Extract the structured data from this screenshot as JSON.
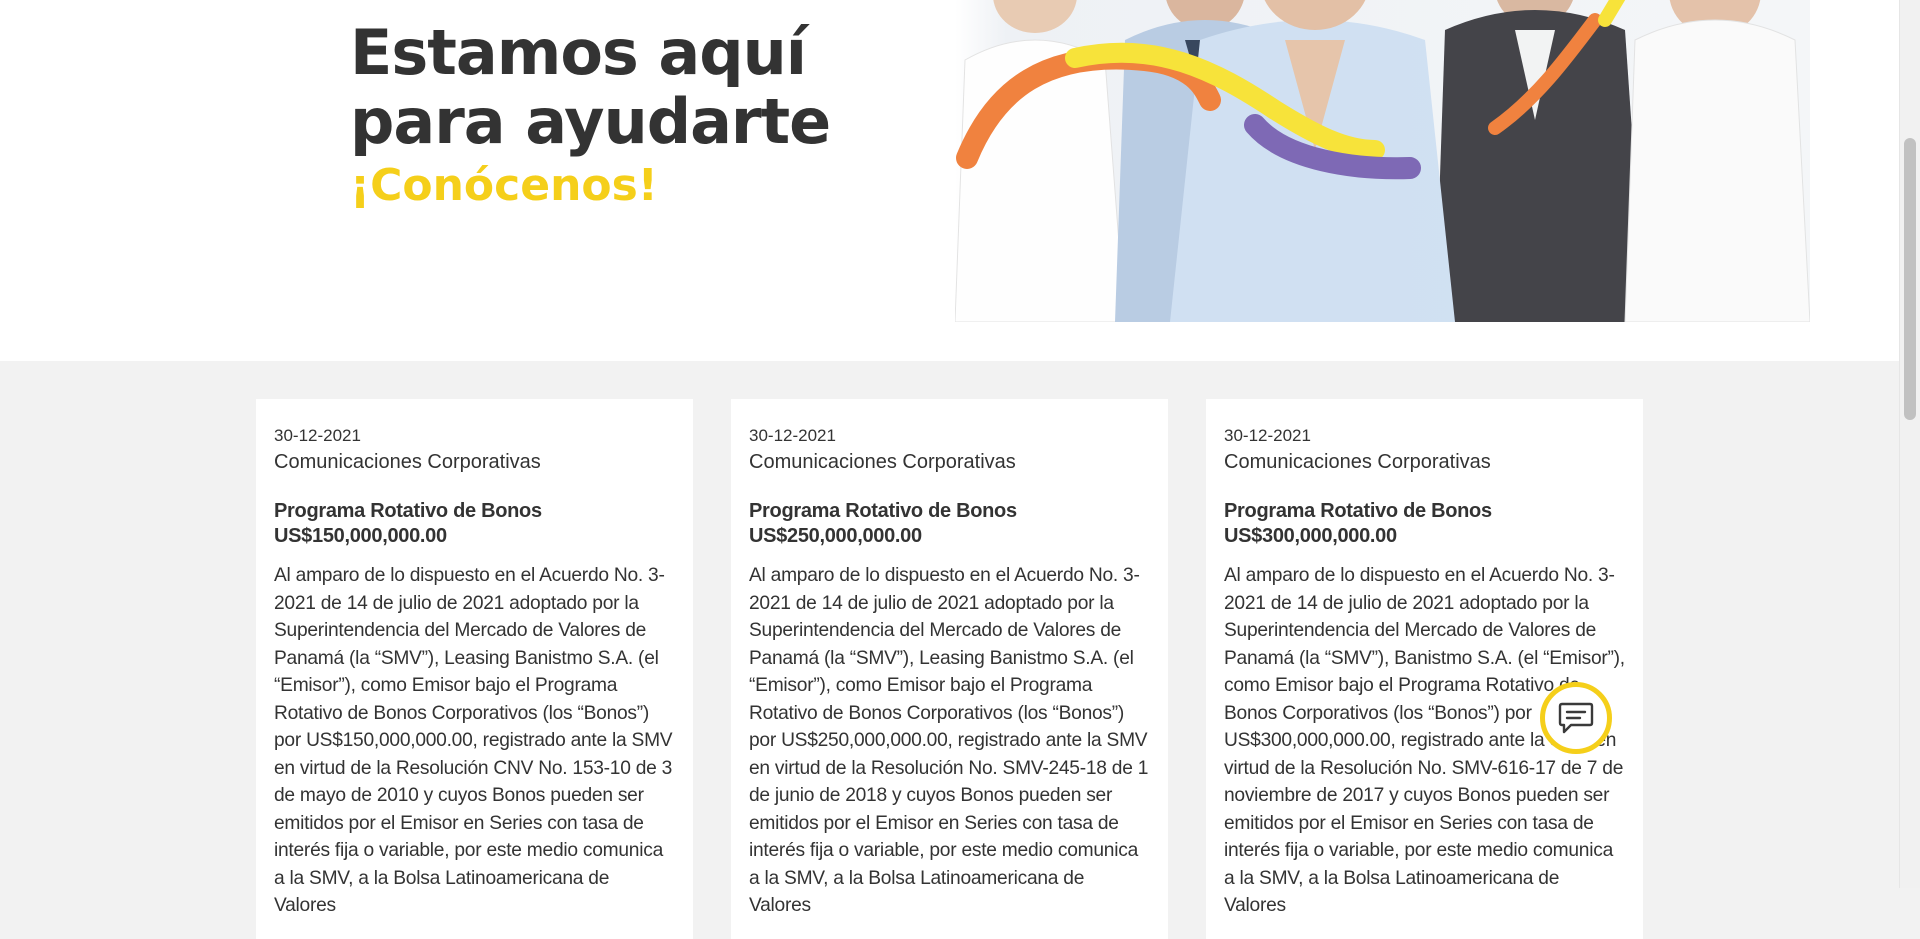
{
  "hero": {
    "title": "Estamos aquí para ayudarte",
    "subtitle": "¡Conócenos!"
  },
  "colors": {
    "accent_yellow": "#f5cf1a",
    "accent_orange": "#f0823f",
    "accent_purple": "#7e69b5",
    "text_dark": "#333333",
    "section_bg": "#f2f2f2"
  },
  "cards": [
    {
      "date": "30-12-2021",
      "category": "Comunicaciones Corporativas",
      "title": "Programa Rotativo de Bonos US$150,000,000.00",
      "body": "Al amparo de lo dispuesto en el Acuerdo No. 3-2021 de 14 de julio de 2021 adoptado por la Superintendencia del Mercado de Valores de Panamá (la “SMV”), Leasing Banistmo S.A. (el “Emisor”), como Emisor bajo el Programa Rotativo de Bonos Corporativos (los “Bonos”) por US$150,000,000.00, registrado ante la SMV en virtud de la Resolución CNV No. 153-10 de 3 de mayo de 2010 y cuyos Bonos pueden ser emitidos por el Emisor en Series con tasa de interés fija o variable, por este medio comunica a la SMV, a la Bolsa Latinoamericana de Valores"
    },
    {
      "date": "30-12-2021",
      "category": "Comunicaciones Corporativas",
      "title": "Programa Rotativo de Bonos US$250,000,000.00",
      "body": "Al amparo de lo dispuesto en el Acuerdo No. 3-2021 de 14 de julio de 2021 adoptado por la Superintendencia del Mercado de Valores de Panamá (la “SMV”), Leasing Banistmo S.A. (el “Emisor”), como Emisor bajo el Programa Rotativo de Bonos Corporativos (los “Bonos”) por US$250,000,000.00, registrado ante la SMV en virtud de la Resolución No. SMV-245-18 de 1 de junio de 2018 y cuyos Bonos pueden ser emitidos por el Emisor en Series con tasa de interés fija o variable, por este medio comunica a la SMV, a la Bolsa Latinoamericana de Valores"
    },
    {
      "date": "30-12-2021",
      "category": "Comunicaciones Corporativas",
      "title": "Programa Rotativo de Bonos US$300,000,000.00",
      "body": "Al amparo de lo dispuesto en el Acuerdo No. 3-2021 de 14 de julio de 2021 adoptado por la Superintendencia del Mercado de Valores de Panamá (la “SMV”), Banistmo S.A. (el “Emisor”), como Emisor bajo el Programa Rotativo de Bonos Corporativos (los “Bonos”) por US$300,000,000.00, registrado ante la SMV en virtud de la Resolución No. SMV-616-17 de 7 de noviembre de 2017 y cuyos Bonos pueden ser emitidos por el Emisor en Series con tasa de interés fija o variable, por este medio comunica a la SMV, a la Bolsa Latinoamericana de Valores"
    }
  ],
  "chat": {
    "icon": "chat-bubble-icon"
  }
}
